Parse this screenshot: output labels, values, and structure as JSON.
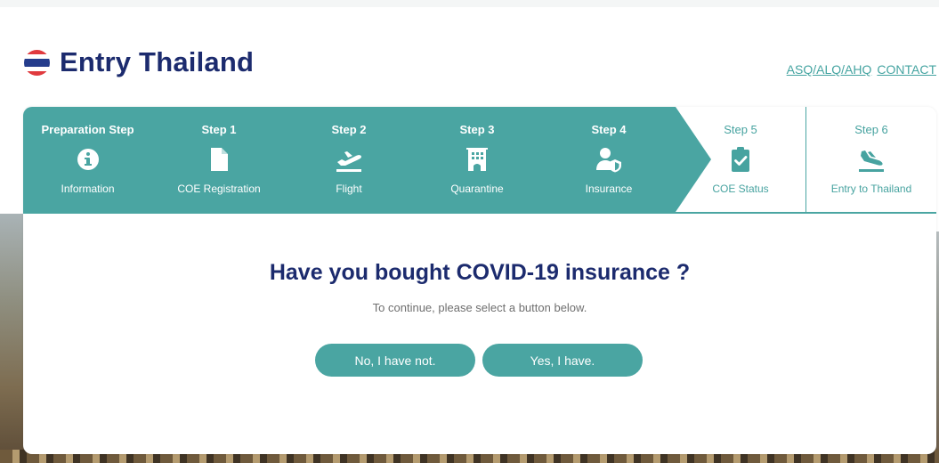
{
  "brand": {
    "title": "Entry Thailand"
  },
  "top_links": [
    "ASQ/ALQ/AHQ",
    "CONTACT"
  ],
  "steps": [
    {
      "title": "Preparation Step",
      "label": "Information",
      "icon": "info-circle-icon",
      "status": "done"
    },
    {
      "title": "Step 1",
      "label": "COE Registration",
      "icon": "document-icon",
      "status": "done"
    },
    {
      "title": "Step 2",
      "label": "Flight",
      "icon": "plane-takeoff-icon",
      "status": "done"
    },
    {
      "title": "Step 3",
      "label": "Quarantine",
      "icon": "hotel-building-icon",
      "status": "done"
    },
    {
      "title": "Step 4",
      "label": "Insurance",
      "icon": "user-shield-icon",
      "status": "current"
    },
    {
      "title": "Step 5",
      "label": "COE Status",
      "icon": "clipboard-check-icon",
      "status": "todo"
    },
    {
      "title": "Step 6",
      "label": "Entry to Thailand",
      "icon": "plane-landing-icon",
      "status": "todo"
    }
  ],
  "main": {
    "question": "Have you bought COVID-19 insurance ?",
    "instruction": "To continue, please select a button below.",
    "no_button": "No, I have not.",
    "yes_button": "Yes, I have."
  },
  "colors": {
    "accent": "#4aa5a2",
    "brand_navy": "#1c2b6e",
    "flag_red": "#e03a3e",
    "flag_blue": "#243c8c"
  }
}
